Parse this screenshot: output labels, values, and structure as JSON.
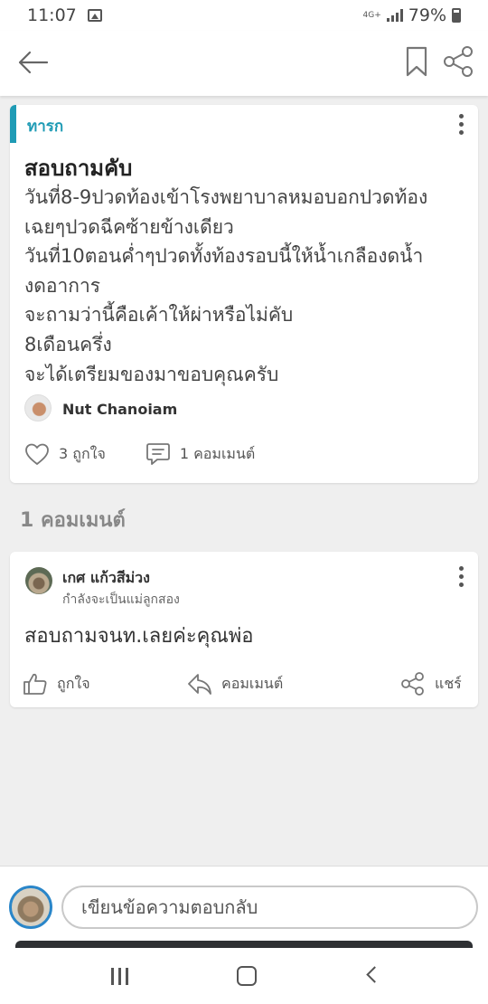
{
  "status_bar": {
    "time": "11:07",
    "network": "4G+",
    "battery": "79%",
    "icons": [
      "image-notification-icon",
      "signal-icon",
      "battery-icon"
    ]
  },
  "header": {
    "icons": [
      "back-arrow-icon",
      "bookmark-icon",
      "share-icon"
    ],
    "accent_color": "#1f9bb5"
  },
  "post": {
    "tag": "ทารก",
    "title": "สอบถามคับ",
    "body_lines": [
      "วันที่8-9ปวดท้องเข้าโรงพยาบาลหมอบอกปวดท้อง",
      "เฉยๆปวดฉีคซ้ายข้างเดียว",
      "วันที่10ตอนค่ำๆปวดทั้งท้องรอบนี้ให้น้ำเกลืองดน้ำ",
      "งดอาการ",
      "จะถามว่านี้คือเค้าให้ผ่าหรือไม่คับ",
      "8เดือนครึ่ง",
      "จะได้เตรียมของมาขอบคุณครับ"
    ],
    "author": "Nut Chanoiam",
    "likes": "3 ถูกใจ",
    "comments": "1 คอมเมนต์"
  },
  "comments_section": {
    "heading": "1 คอมเมนต์",
    "items": [
      {
        "name": "เกศ แก้วสีม่วง",
        "subtitle": "กำลังจะเป็นแม่ลูกสอง",
        "text": "สอบถามจนท.เลยค่ะคุณพ่อ",
        "like_label": "ถูกใจ",
        "comment_label": "คอมเมนต์",
        "share_label": "แชร์"
      }
    ]
  },
  "reply": {
    "placeholder": "เขียนข้อความตอบกลับ"
  },
  "nav": {
    "icons": [
      "recent-apps-icon",
      "home-icon",
      "back-icon"
    ]
  }
}
